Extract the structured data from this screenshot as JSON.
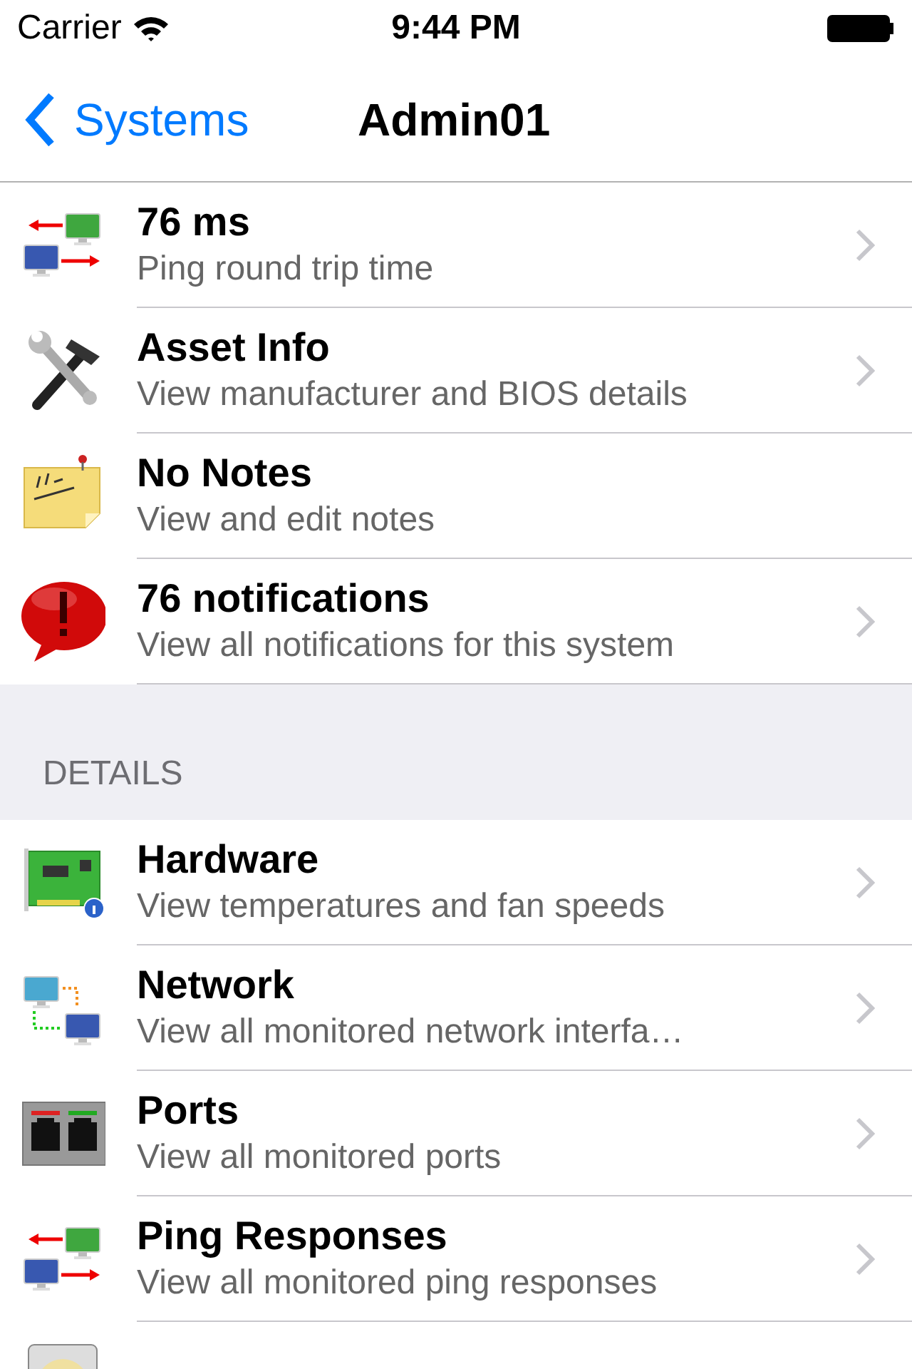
{
  "status_bar": {
    "carrier": "Carrier",
    "time": "9:44 PM"
  },
  "nav": {
    "back": "Systems",
    "title": "Admin01"
  },
  "sections": [
    {
      "items": [
        {
          "kind": "ping",
          "title": "76 ms",
          "subtitle": "Ping round trip time",
          "chevron": true
        },
        {
          "kind": "tools",
          "title": "Asset Info",
          "subtitle": "View manufacturer and BIOS details",
          "chevron": true
        },
        {
          "kind": "note",
          "title": "No Notes",
          "subtitle": "View and edit notes",
          "chevron": false
        },
        {
          "kind": "alert",
          "title": "76 notifications",
          "subtitle": "View all notifications for this system",
          "chevron": true
        }
      ]
    },
    {
      "header": "DETAILS",
      "items": [
        {
          "kind": "board",
          "title": "Hardware",
          "subtitle": "View temperatures and fan speeds",
          "chevron": true
        },
        {
          "kind": "network",
          "title": "Network",
          "subtitle": "View all monitored network interfa…",
          "chevron": true
        },
        {
          "kind": "ports",
          "title": "Ports",
          "subtitle": "View all monitored ports",
          "chevron": true
        },
        {
          "kind": "ping",
          "title": "Ping Responses",
          "subtitle": "View all monitored ping responses",
          "chevron": true
        },
        {
          "kind": "disk"
        }
      ]
    }
  ]
}
